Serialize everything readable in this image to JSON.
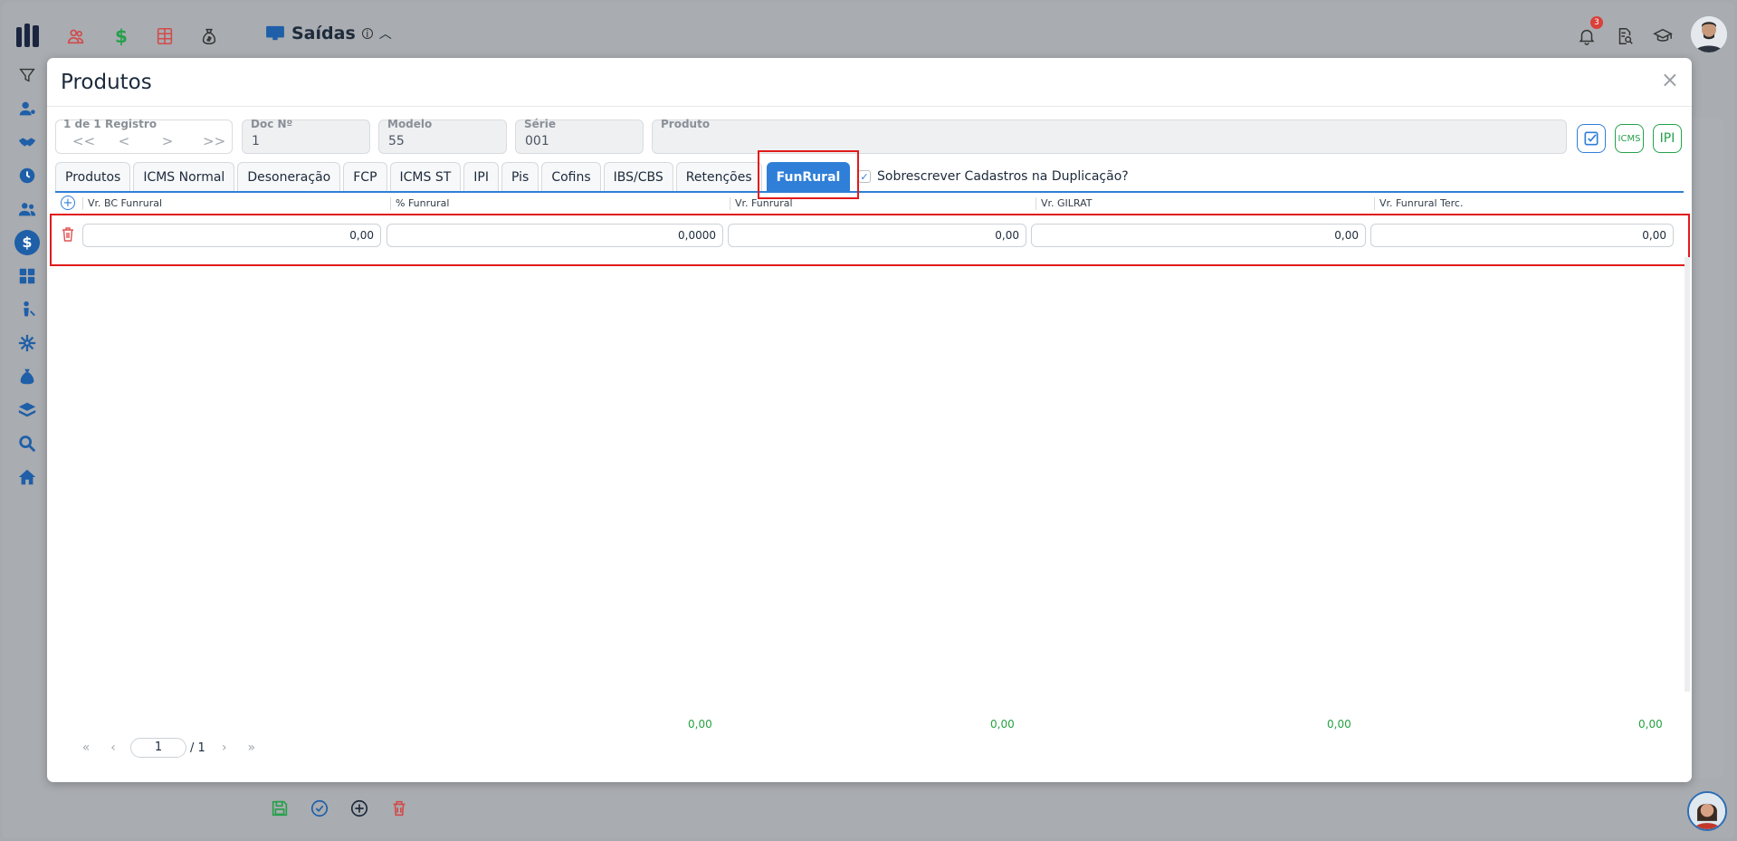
{
  "app": {
    "title": "Saídas",
    "notification_count": "3"
  },
  "modal": {
    "title": "Produtos",
    "close_label": "×",
    "record_nav": {
      "label": "1 de 1 Registro",
      "first": "<<",
      "prev": "<",
      "next": ">",
      "last": ">>"
    },
    "fields": {
      "doc": {
        "label": "Doc Nº",
        "value": "1"
      },
      "modelo": {
        "label": "Modelo",
        "value": "55"
      },
      "serie": {
        "label": "Série",
        "value": "001"
      },
      "produto": {
        "label": "Produto",
        "value": ""
      }
    },
    "actions": {
      "icms": "ICMS",
      "ipi": "IPI"
    },
    "tabs": [
      "Produtos",
      "ICMS Normal",
      "Desoneração",
      "FCP",
      "ICMS ST",
      "IPI",
      "Pis",
      "Cofins",
      "IBS/CBS",
      "Retenções",
      "FunRural"
    ],
    "active_tab": "FunRural",
    "overwrite_label": "Sobrescrever Cadastros na Duplicação?",
    "grid": {
      "columns": [
        "Vr. BC Funrural",
        "% Funrural",
        "Vr. Funrural",
        "Vr. GILRAT",
        "Vr. Funrural Terc."
      ],
      "rows": [
        [
          "0,00",
          "0,0000",
          "0,00",
          "0,00",
          "0,00"
        ]
      ],
      "totals": [
        "0,00",
        "0,00",
        "0,00",
        "0,00"
      ]
    },
    "pager": {
      "page": "1",
      "total": "/ 1"
    }
  },
  "colors": {
    "accent": "#2f7fd8",
    "highlight": "#e11b1b",
    "total_green": "#27a243"
  }
}
